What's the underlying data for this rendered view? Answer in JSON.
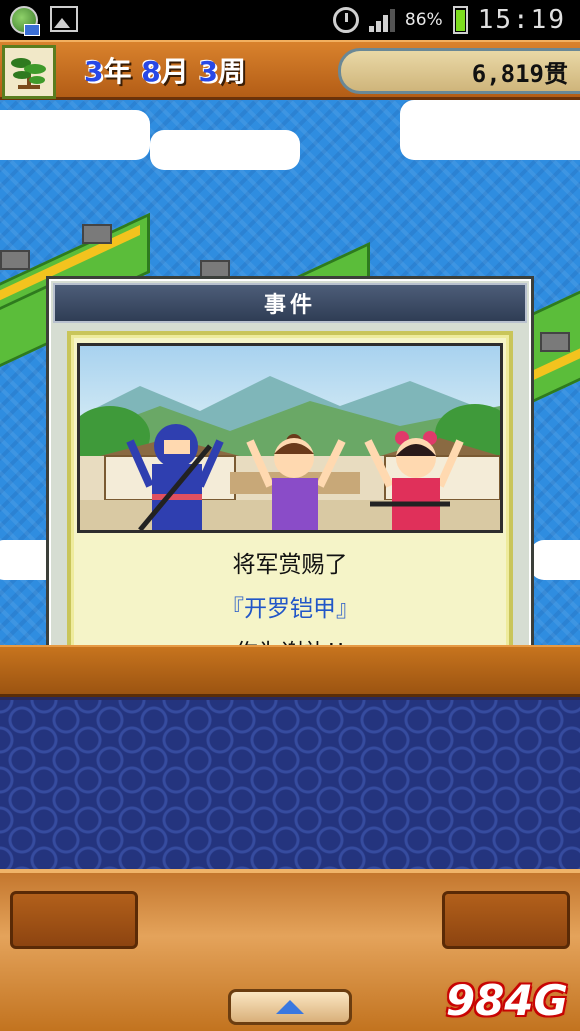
{
  "status_bar": {
    "battery_percent": "86%",
    "battery_level": 0.86,
    "time": "15:19",
    "icons": [
      "game-notification-icon",
      "image-notification-icon",
      "alarm-icon",
      "signal-icon",
      "battery-icon"
    ]
  },
  "top_bar": {
    "date_year": "3",
    "date_year_unit": "年",
    "date_month": "8",
    "date_month_unit": "月",
    "date_week": "3",
    "date_week_unit": "周",
    "money": "6,819贯",
    "menu_icon": "pine-tree-icon"
  },
  "dialog": {
    "title": "事件",
    "message_line1": "将军赏赐了",
    "item_open": "『",
    "item_name": "开罗铠甲",
    "item_close": "』",
    "message_line3": "作为谢礼!!"
  },
  "watermark": "984G",
  "colors": {
    "sea": "#2f8de0",
    "wood": "#c7741e",
    "dialog_header": "#2f3d55",
    "item_text": "#2156c8",
    "date_number": "#2848e6"
  }
}
